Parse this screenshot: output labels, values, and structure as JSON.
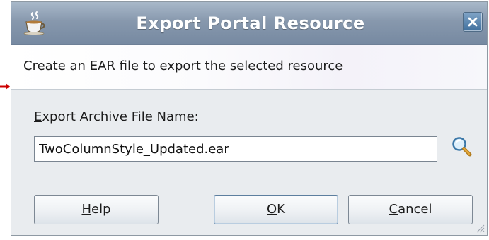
{
  "dialog": {
    "title": "Export Portal Resource",
    "description": "Create an EAR file to export the selected resource"
  },
  "field": {
    "label_mnemonic": "E",
    "label_rest": "xport Archive File Name:",
    "value": "TwoColumnStyle_Updated.ear"
  },
  "buttons": {
    "help_mnemonic": "H",
    "help_rest": "elp",
    "ok_mnemonic": "O",
    "ok_rest": "K",
    "cancel_mnemonic": "C",
    "cancel_rest": "ancel"
  },
  "icons": {
    "app": "coffee-cup-icon",
    "close": "close-icon",
    "browse": "magnifier-icon",
    "resize": "resize-grip-icon"
  },
  "colors": {
    "titlebar": "#8798ad",
    "dialog_bg": "#e9ecef",
    "annotation_arrow": "#cc0000"
  }
}
